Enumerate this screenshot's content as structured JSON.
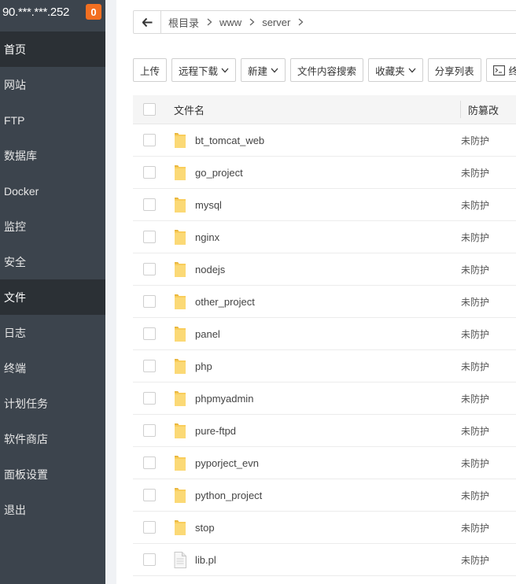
{
  "sidebar": {
    "server_ip": "90.***.***.252",
    "badge_count": "0",
    "items": [
      {
        "label": "首页",
        "active": true
      },
      {
        "label": "网站",
        "active": false
      },
      {
        "label": "FTP",
        "active": false
      },
      {
        "label": "数据库",
        "active": false
      },
      {
        "label": "Docker",
        "active": false
      },
      {
        "label": "监控",
        "active": false
      },
      {
        "label": "安全",
        "active": false
      },
      {
        "label": "文件",
        "active": true
      },
      {
        "label": "日志",
        "active": false
      },
      {
        "label": "终端",
        "active": false
      },
      {
        "label": "计划任务",
        "active": false
      },
      {
        "label": "软件商店",
        "active": false
      },
      {
        "label": "面板设置",
        "active": false
      },
      {
        "label": "退出",
        "active": false
      }
    ]
  },
  "breadcrumb": {
    "back_icon": "arrow-left-icon",
    "parts": [
      "根目录",
      "www",
      "server"
    ]
  },
  "toolbar": {
    "upload": "上传",
    "remote_download": "远程下载",
    "new": "新建",
    "content_search": "文件内容搜索",
    "favorites": "收藏夹",
    "share_list": "分享列表",
    "terminal": "终端"
  },
  "table": {
    "header_name": "文件名",
    "header_protect": "防篡改",
    "rows": [
      {
        "name": "bt_tomcat_web",
        "type": "folder",
        "protect": "未防护"
      },
      {
        "name": "go_project",
        "type": "folder",
        "protect": "未防护"
      },
      {
        "name": "mysql",
        "type": "folder",
        "protect": "未防护"
      },
      {
        "name": "nginx",
        "type": "folder",
        "protect": "未防护"
      },
      {
        "name": "nodejs",
        "type": "folder",
        "protect": "未防护"
      },
      {
        "name": "other_project",
        "type": "folder",
        "protect": "未防护"
      },
      {
        "name": "panel",
        "type": "folder",
        "protect": "未防护"
      },
      {
        "name": "php",
        "type": "folder",
        "protect": "未防护"
      },
      {
        "name": "phpmyadmin",
        "type": "folder",
        "protect": "未防护"
      },
      {
        "name": "pure-ftpd",
        "type": "folder",
        "protect": "未防护"
      },
      {
        "name": "pyporject_evn",
        "type": "folder",
        "protect": "未防护"
      },
      {
        "name": "python_project",
        "type": "folder",
        "protect": "未防护"
      },
      {
        "name": "stop",
        "type": "folder",
        "protect": "未防护"
      },
      {
        "name": "lib.pl",
        "type": "file",
        "protect": "未防护"
      }
    ]
  },
  "colors": {
    "sidebar_bg": "#3c444d",
    "sidebar_active": "#2b3035",
    "badge": "#f26f21",
    "folder": "#f9cd5b"
  }
}
